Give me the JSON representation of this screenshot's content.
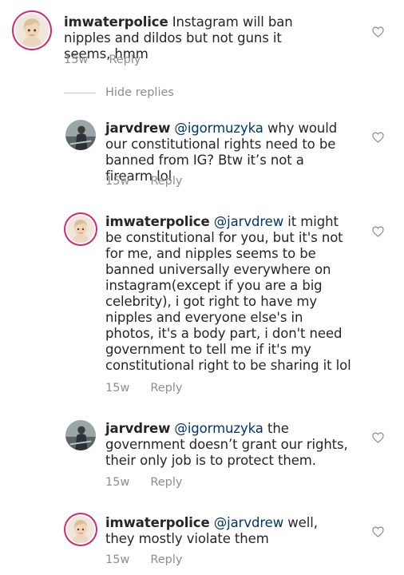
{
  "comments": [
    {
      "username": "imwaterpolice",
      "mention": "",
      "text": "Instagram will ban nipples and dildos but not guns it seems, hmm",
      "time": "15w",
      "reply_label": "Reply"
    },
    {
      "username": "jarvdrew",
      "mention": "@igormuzyka",
      "text": "why would our constitutional rights need to be banned from IG? Btw it’s not a firearm lol",
      "time": "15w",
      "reply_label": "Reply"
    },
    {
      "username": "imwaterpolice",
      "mention": "@jarvdrew",
      "text": "it might be constitutional for you, but it's not for me, and nipples seems to be banned universally everywhere on instagram(except if you are a big celebrity), i got right to have my nipples and everyone else's in photos, it's a body part, i don't need government to tell me if it's my constitutional right to be sharing it lol",
      "time": "15w",
      "reply_label": "Reply"
    },
    {
      "username": "jarvdrew",
      "mention": "@igormuzyka",
      "text": "the government doesn’t grant our rights, their only job is to protect them.",
      "time": "15w",
      "reply_label": "Reply"
    },
    {
      "username": "imwaterpolice",
      "mention": "@jarvdrew",
      "text": "well, they mostly violate them",
      "time": "15w",
      "reply_label": "Reply"
    }
  ],
  "hide_replies_label": "Hide replies",
  "colors": {
    "text": "#262626",
    "mention": "#00376b",
    "meta": "#8e8e8e",
    "story_ring": "#d6276e"
  },
  "icons": {
    "like": "heart-outline-icon",
    "avatar_imwaterpolice": "memoji-avatar",
    "avatar_jarvdrew": "photo-avatar"
  }
}
